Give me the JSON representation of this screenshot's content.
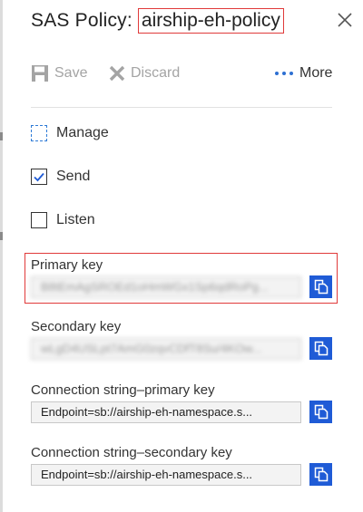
{
  "panel": {
    "title_prefix": "SAS Policy:",
    "title_name": "airship-eh-policy"
  },
  "toolbar": {
    "save_label": "Save",
    "discard_label": "Discard",
    "more_label": "More"
  },
  "claims": [
    {
      "label": "Manage",
      "checked": false
    },
    {
      "label": "Send",
      "checked": true
    },
    {
      "label": "Listen",
      "checked": false
    }
  ],
  "fields": {
    "primary_key": {
      "label": "Primary key",
      "value": "B8tEmAgSROEd1oHmWGx1Sp6qdRoPg..."
    },
    "secondary_key": {
      "label": "Secondary key",
      "value": "wLgD4USLpt7AmG0zqvCDfT8Su/4KOw..."
    },
    "conn_primary": {
      "label": "Connection string–primary key",
      "value": "Endpoint=sb://airship-eh-namespace.s..."
    },
    "conn_secondary": {
      "label": "Connection string–secondary key",
      "value": "Endpoint=sb://airship-eh-namespace.s..."
    }
  },
  "colors": {
    "accent": "#1f5bd6",
    "highlight": "#e03a3a",
    "disabled": "#a4a4a4"
  }
}
